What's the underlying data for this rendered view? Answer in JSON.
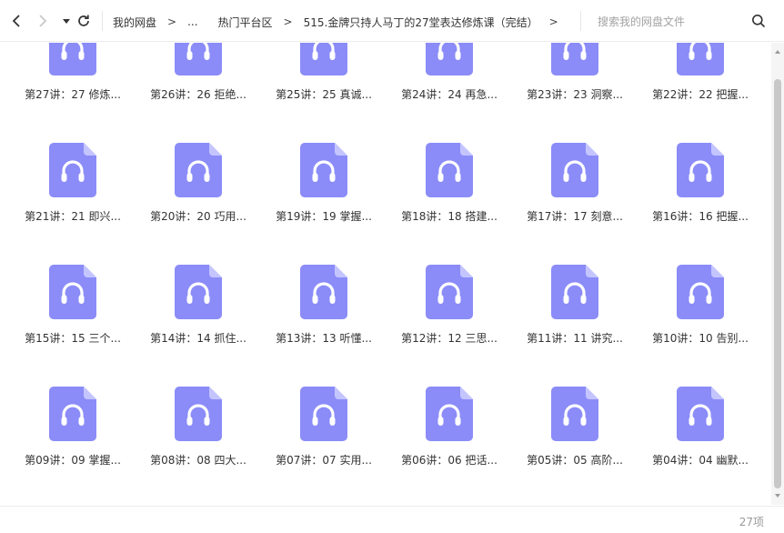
{
  "toolbar": {
    "breadcrumbs": [
      "我的网盘",
      "...",
      "热门平台区",
      "515.金牌只持人马丁的27堂表达修炼课（完结）"
    ],
    "separator": ">",
    "trailing_separator": ">",
    "search_placeholder": "搜索我的网盘文件"
  },
  "colors": {
    "icon_fill": "#8b8cf8",
    "icon_fold": "#c4c5ff",
    "accent": "#5b5ce6"
  },
  "files": [
    {
      "name": "第27讲：27 修炼...",
      "icon": "audio-file-icon"
    },
    {
      "name": "第26讲：26 拒绝...",
      "icon": "audio-file-icon"
    },
    {
      "name": "第25讲：25 真诚...",
      "icon": "audio-file-icon"
    },
    {
      "name": "第24讲：24 再急...",
      "icon": "audio-file-icon"
    },
    {
      "name": "第23讲：23 洞察...",
      "icon": "audio-file-icon"
    },
    {
      "name": "第22讲：22 把握...",
      "icon": "audio-file-icon"
    },
    {
      "name": "第21讲：21 即兴...",
      "icon": "audio-file-icon"
    },
    {
      "name": "第20讲：20 巧用...",
      "icon": "audio-file-icon"
    },
    {
      "name": "第19讲：19 掌握...",
      "icon": "audio-file-icon"
    },
    {
      "name": "第18讲：18 搭建...",
      "icon": "audio-file-icon"
    },
    {
      "name": "第17讲：17 刻意...",
      "icon": "audio-file-icon"
    },
    {
      "name": "第16讲：16 把握...",
      "icon": "audio-file-icon"
    },
    {
      "name": "第15讲：15 三个...",
      "icon": "audio-file-icon"
    },
    {
      "name": "第14讲：14 抓住...",
      "icon": "audio-file-icon"
    },
    {
      "name": "第13讲：13 听懂...",
      "icon": "audio-file-icon"
    },
    {
      "name": "第12讲：12 三思...",
      "icon": "audio-file-icon"
    },
    {
      "name": "第11讲：11 讲究...",
      "icon": "audio-file-icon"
    },
    {
      "name": "第10讲：10 告别...",
      "icon": "audio-file-icon"
    },
    {
      "name": "第09讲：09 掌握...",
      "icon": "audio-file-icon"
    },
    {
      "name": "第08讲：08 四大...",
      "icon": "audio-file-icon"
    },
    {
      "name": "第07讲：07 实用...",
      "icon": "audio-file-icon"
    },
    {
      "name": "第06讲：06 把话...",
      "icon": "audio-file-icon"
    },
    {
      "name": "第05讲：05 高阶...",
      "icon": "audio-file-icon"
    },
    {
      "name": "第04讲：04 幽默...",
      "icon": "audio-file-icon"
    }
  ],
  "status": {
    "item_count": "27项"
  }
}
